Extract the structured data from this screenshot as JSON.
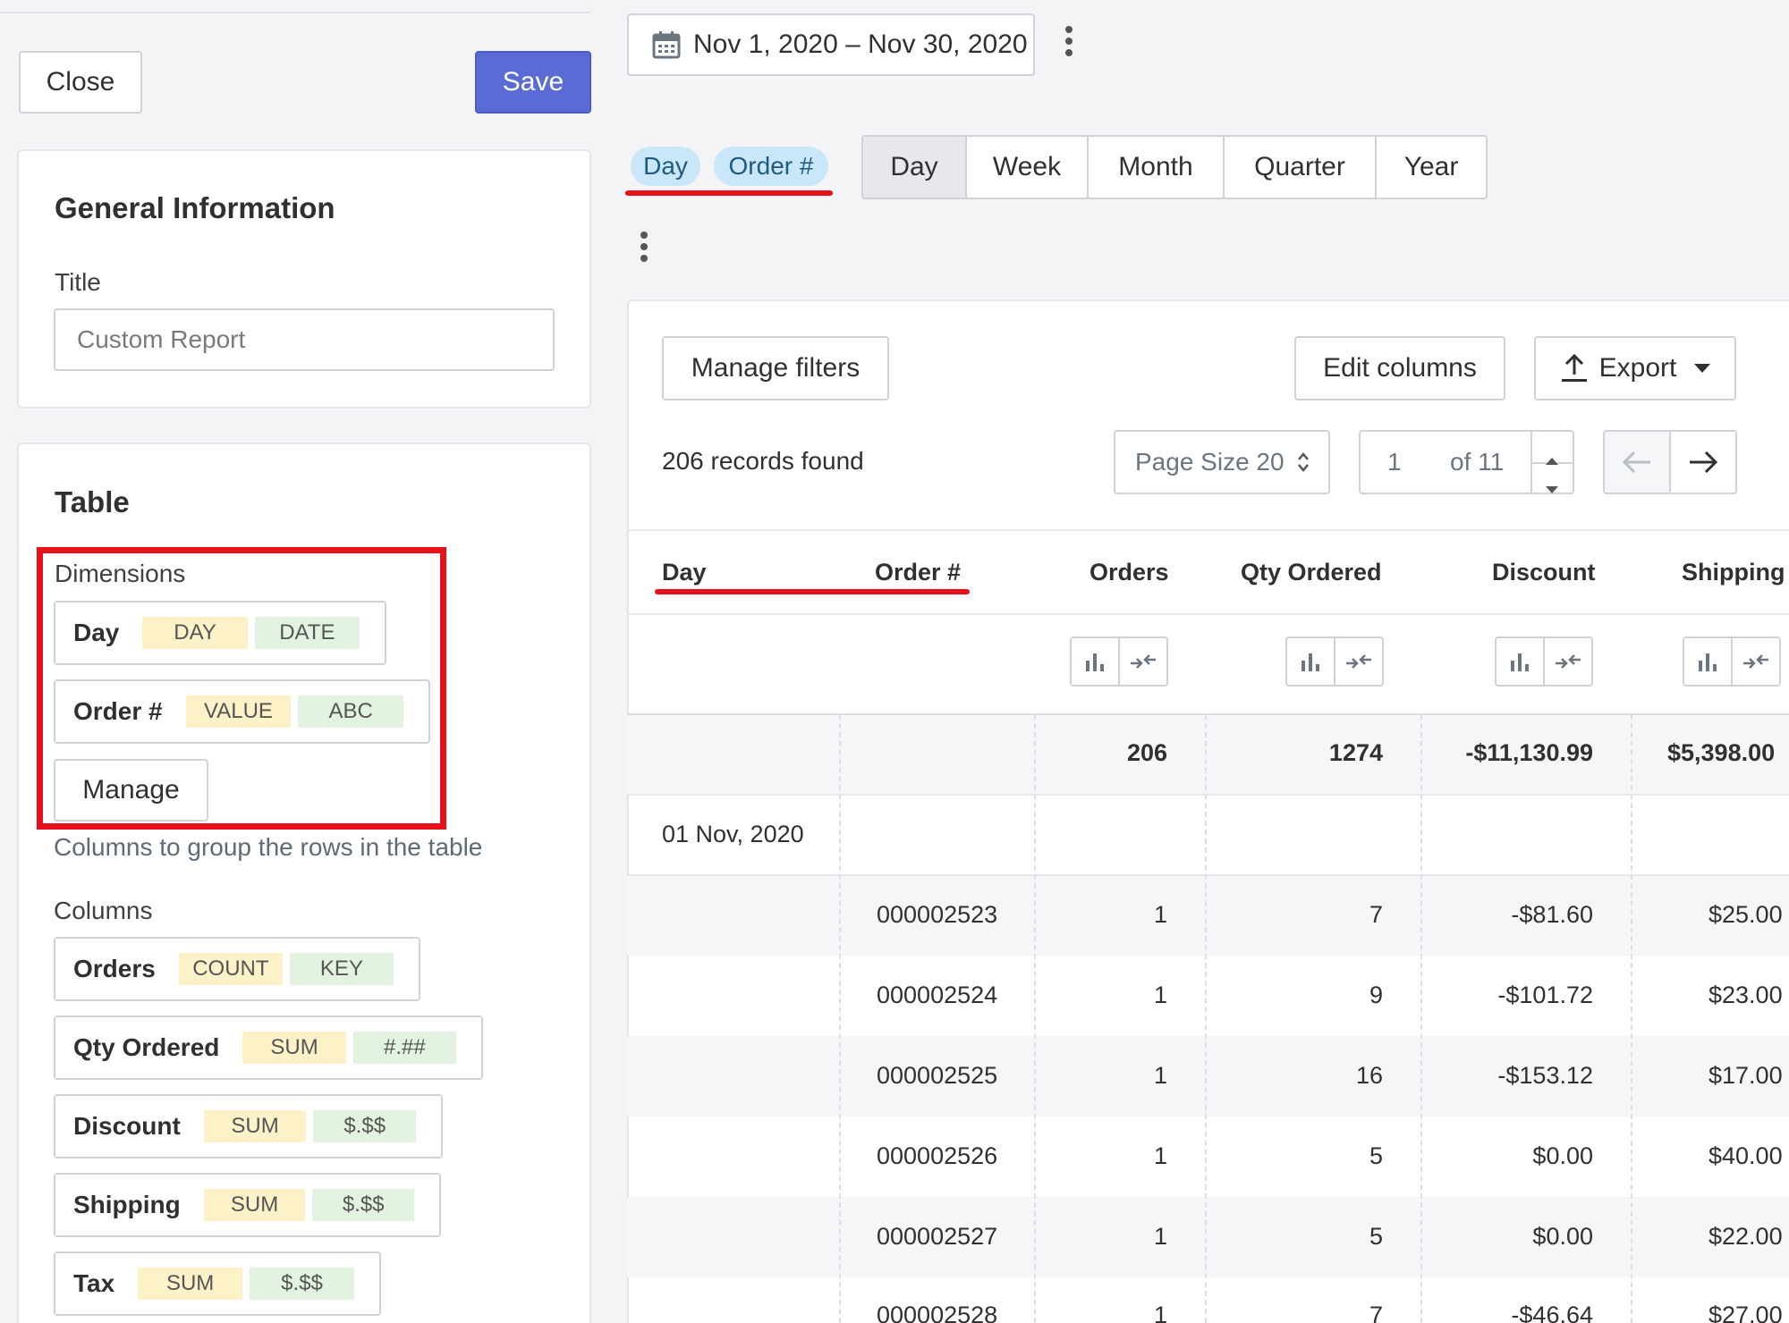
{
  "toolbar": {
    "close_label": "Close",
    "save_label": "Save"
  },
  "general": {
    "title": "General Information",
    "title_label": "Title",
    "title_value": "Custom Report"
  },
  "table_card": {
    "title": "Table",
    "dimensions_label": "Dimensions",
    "dimensions": [
      {
        "name": "Day",
        "tag1": "DAY",
        "tag2": "DATE"
      },
      {
        "name": "Order #",
        "tag1": "VALUE",
        "tag2": "ABC"
      }
    ],
    "manage_label": "Manage",
    "dimensions_help": "Columns to group the rows in the table",
    "columns_label": "Columns",
    "columns": [
      {
        "name": "Orders",
        "tag1": "COUNT",
        "tag2": "KEY"
      },
      {
        "name": "Qty Ordered",
        "tag1": "SUM",
        "tag2": "#.##"
      },
      {
        "name": "Discount",
        "tag1": "SUM",
        "tag2": "$.$$"
      },
      {
        "name": "Shipping",
        "tag1": "SUM",
        "tag2": "$.$$"
      },
      {
        "name": "Tax",
        "tag1": "SUM",
        "tag2": "$.$$"
      }
    ]
  },
  "date_range": {
    "label": "Nov 1, 2020 – Nov 30, 2020",
    "icon": "calendar-icon"
  },
  "group_pills": [
    "Day",
    "Order #"
  ],
  "period_tabs": [
    {
      "label": "Day",
      "active": true
    },
    {
      "label": "Week",
      "active": false
    },
    {
      "label": "Month",
      "active": false
    },
    {
      "label": "Quarter",
      "active": false
    },
    {
      "label": "Year",
      "active": false
    }
  ],
  "report": {
    "manage_filters_label": "Manage filters",
    "edit_columns_label": "Edit columns",
    "export_label": "Export",
    "records_found": "206 records found",
    "page_size_label": "Page Size 20",
    "page_current": "1",
    "page_of": "of 11"
  },
  "table": {
    "headers": [
      "Day",
      "Order #",
      "Orders",
      "Qty Ordered",
      "Discount",
      "Shipping"
    ],
    "totals": {
      "orders": "206",
      "qty": "1274",
      "discount": "-$11,130.99",
      "shipping": "$5,398.00"
    },
    "group_day": "01 Nov, 2020",
    "rows": [
      {
        "order": "000002523",
        "orders": "1",
        "qty": "7",
        "discount": "-$81.60",
        "shipping": "$25.00"
      },
      {
        "order": "000002524",
        "orders": "1",
        "qty": "9",
        "discount": "-$101.72",
        "shipping": "$23.00"
      },
      {
        "order": "000002525",
        "orders": "1",
        "qty": "16",
        "discount": "-$153.12",
        "shipping": "$17.00"
      },
      {
        "order": "000002526",
        "orders": "1",
        "qty": "5",
        "discount": "$0.00",
        "shipping": "$40.00"
      },
      {
        "order": "000002527",
        "orders": "1",
        "qty": "5",
        "discount": "$0.00",
        "shipping": "$22.00"
      },
      {
        "order": "000002528",
        "orders": "1",
        "qty": "7",
        "discount": "-$46.64",
        "shipping": "$27.00"
      }
    ]
  },
  "colors": {
    "accent": "#5b6bd6",
    "annotation_red": "#e8111b",
    "pill_blue": "#c9e7f8",
    "tag_yellow": "#fdf1c8",
    "tag_green": "#e2f3e1"
  }
}
